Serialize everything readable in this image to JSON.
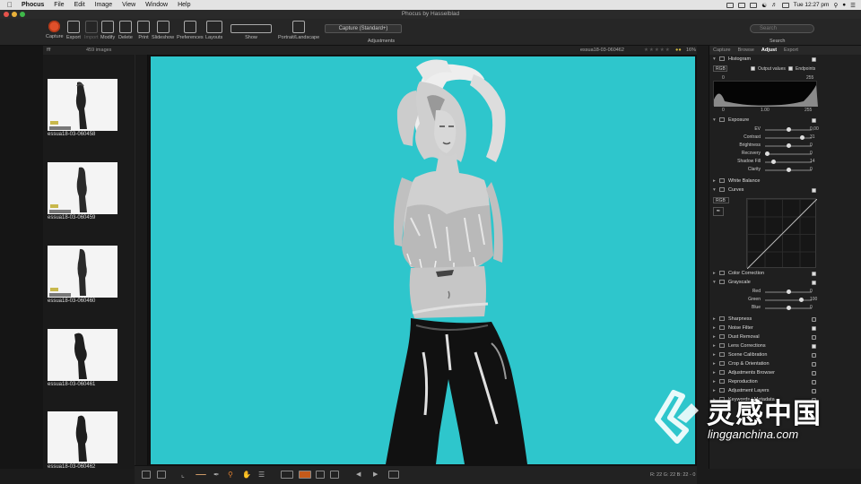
{
  "menubar": {
    "app": "Phocus",
    "items": [
      "File",
      "Edit",
      "Image",
      "View",
      "Window",
      "Help"
    ],
    "clock": "Tue 12:27 pm"
  },
  "window": {
    "title": "Phocus by Hasselblad"
  },
  "toolbar": {
    "buttons": [
      "Capture",
      "Export",
      "Import",
      "Modify",
      "Delete",
      "Print",
      "Slideshow",
      "Preferences",
      "Layouts",
      "Show",
      "Portrait/Landscape",
      "Adjustments",
      "Search"
    ],
    "capture_select": "Capture (Standard+)",
    "search_placeholder": "Search"
  },
  "browser": {
    "filter": "fff",
    "count": "459 images",
    "items": [
      "essua18-03-060458",
      "essua18-03-060459",
      "essua18-03-060460",
      "essua18-03-060461",
      "essua18-03-060462"
    ]
  },
  "viewer": {
    "filename": "essua18-03-060462",
    "zoom": "16%",
    "background": "#2ec6cc"
  },
  "bottom": {
    "readout": "R: 22  G: 22  B: 22  - 0"
  },
  "panel": {
    "tabs": [
      "Capture",
      "Browse",
      "Adjust",
      "Export"
    ],
    "active_tab": "Adjust",
    "histogram": {
      "title": "Histogram",
      "channel": "RGB",
      "output_values": "Output values",
      "endpoints": "Endpoints",
      "left": "0",
      "right": "255",
      "low": "0",
      "gamma": "1.00",
      "high": "255"
    },
    "exposure": {
      "title": "Exposure",
      "rows": [
        {
          "label": "EV",
          "value": "0,00",
          "pos": 0.5
        },
        {
          "label": "Contrast",
          "value": "31",
          "pos": 0.82
        },
        {
          "label": "Brightness",
          "value": "0",
          "pos": 0.5
        },
        {
          "label": "Recovery",
          "value": "0",
          "pos": 0.0
        },
        {
          "label": "Shadow Fill",
          "value": "14",
          "pos": 0.14
        },
        {
          "label": "Clarity",
          "value": "0",
          "pos": 0.5
        }
      ]
    },
    "white_balance": "White Balance",
    "curves": {
      "title": "Curves",
      "channel": "RGB"
    },
    "color_correction": "Color Correction",
    "grayscale": {
      "title": "Grayscale",
      "rows": [
        {
          "label": "Red",
          "value": "0",
          "pos": 0.5
        },
        {
          "label": "Green",
          "value": "100",
          "pos": 0.8
        },
        {
          "label": "Blue",
          "value": "0",
          "pos": 0.5
        }
      ]
    },
    "sections": [
      "Sharpness",
      "Noise Filter",
      "Dust Removal",
      "Lens Corrections",
      "Scene Calibration",
      "Crop & Orientation",
      "Adjustments Browser",
      "Reproduction",
      "Adjustment Layers",
      "Keywords / Metadata"
    ]
  },
  "watermark": {
    "cn": "灵感中国",
    "en": "lingganchina.com"
  }
}
